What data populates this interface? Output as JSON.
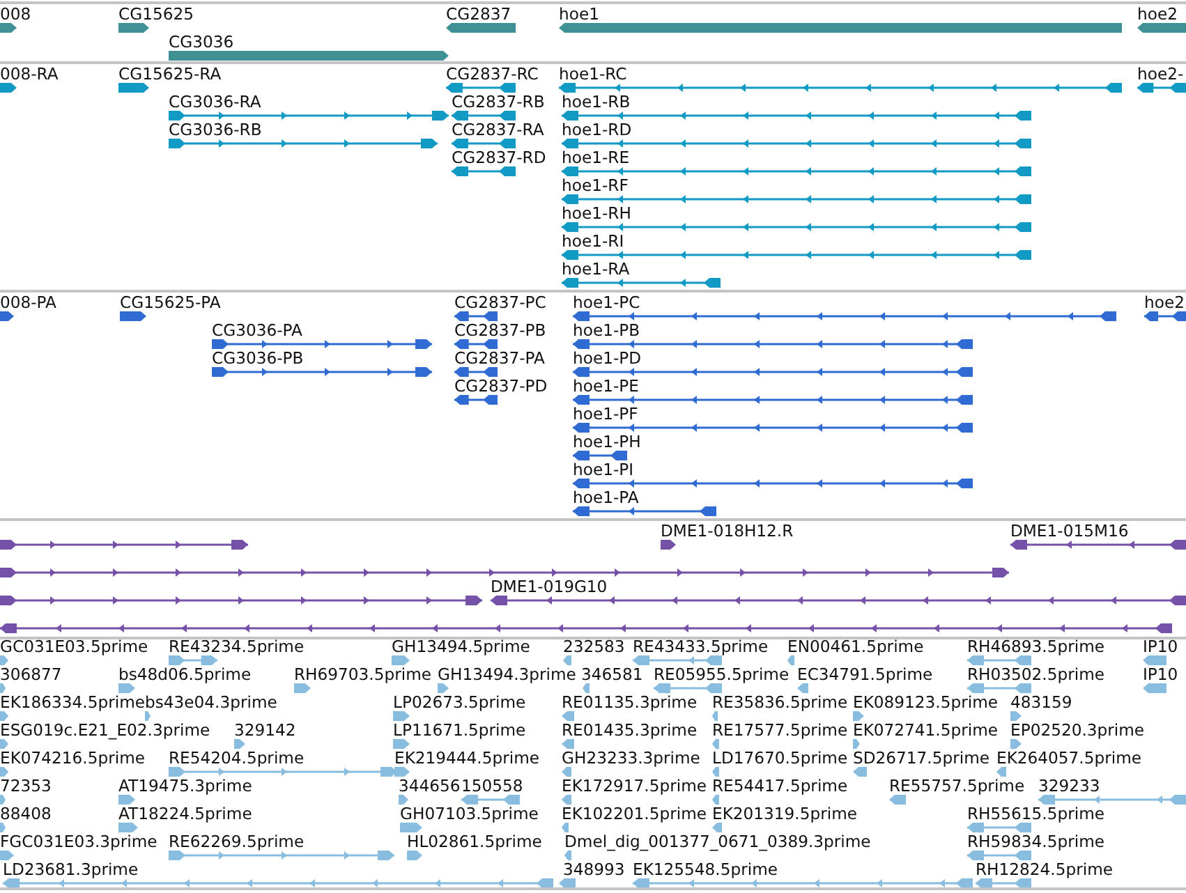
{
  "tracks": [
    {
      "kind": "gene",
      "features": [
        {
          "label": "008",
          "reverse": false
        },
        {
          "label": "CG15625",
          "reverse": false
        },
        {
          "label": "CG3036",
          "reverse": false
        },
        {
          "label": "CG2837",
          "reverse": true
        },
        {
          "label": "hoe1",
          "reverse": true
        },
        {
          "label": "hoe2",
          "reverse": true
        }
      ]
    },
    {
      "kind": "transcript",
      "features": [
        {
          "label": "008-RA",
          "reverse": false
        },
        {
          "label": "CG15625-RA",
          "reverse": false
        },
        {
          "label": "CG3036-RA",
          "reverse": false
        },
        {
          "label": "CG3036-RB",
          "reverse": false
        },
        {
          "label": "CG2837-RC",
          "reverse": true
        },
        {
          "label": "CG2837-RB",
          "reverse": true
        },
        {
          "label": "CG2837-RA",
          "reverse": true
        },
        {
          "label": "CG2837-RD",
          "reverse": true
        },
        {
          "label": "hoe1-RC",
          "reverse": true
        },
        {
          "label": "hoe1-RB",
          "reverse": true
        },
        {
          "label": "hoe1-RD",
          "reverse": true
        },
        {
          "label": "hoe1-RE",
          "reverse": true
        },
        {
          "label": "hoe1-RF",
          "reverse": true
        },
        {
          "label": "hoe1-RH",
          "reverse": true
        },
        {
          "label": "hoe1-RI",
          "reverse": true
        },
        {
          "label": "hoe1-RA",
          "reverse": true
        },
        {
          "label": "hoe2-",
          "reverse": true
        }
      ]
    },
    {
      "kind": "protein",
      "features": [
        {
          "label": "008-PA",
          "reverse": false
        },
        {
          "label": "CG15625-PA",
          "reverse": false
        },
        {
          "label": "CG3036-PA",
          "reverse": false
        },
        {
          "label": "CG3036-PB",
          "reverse": false
        },
        {
          "label": "CG2837-PC",
          "reverse": true
        },
        {
          "label": "CG2837-PB",
          "reverse": true
        },
        {
          "label": "CG2837-PA",
          "reverse": true
        },
        {
          "label": "CG2837-PD",
          "reverse": true
        },
        {
          "label": "hoe1-PC",
          "reverse": true
        },
        {
          "label": "hoe1-PB",
          "reverse": true
        },
        {
          "label": "hoe1-PD",
          "reverse": true
        },
        {
          "label": "hoe1-PE",
          "reverse": true
        },
        {
          "label": "hoe1-PF",
          "reverse": true
        },
        {
          "label": "hoe1-PH",
          "reverse": true
        },
        {
          "label": "hoe1-PI",
          "reverse": true
        },
        {
          "label": "hoe1-PA",
          "reverse": true
        },
        {
          "label": "hoe2",
          "reverse": true
        }
      ]
    },
    {
      "kind": "clone",
      "features": [
        {
          "reverse": false
        },
        {
          "label": "DME1-018H12.R",
          "reverse": false
        },
        {
          "label": "DME1-015M16",
          "reverse": true
        },
        {
          "reverse": false
        },
        {
          "reverse": false
        },
        {
          "label": "DME1-019G10",
          "reverse": true
        },
        {
          "reverse": true
        }
      ]
    },
    {
      "kind": "est",
      "features": [
        {
          "label": "GC031E03.5prime",
          "reverse": false
        },
        {
          "label": "RE43234.5prime",
          "reverse": false
        },
        {
          "label": "GH13494.5prime",
          "reverse": false
        },
        {
          "label": "232583",
          "reverse": true
        },
        {
          "label": "RE43433.5prime",
          "reverse": true
        },
        {
          "label": "EN00461.5prime",
          "reverse": true
        },
        {
          "label": "RH46893.5prime",
          "reverse": true
        },
        {
          "label": "IP10",
          "reverse": true
        },
        {
          "label": "306877",
          "reverse": false
        },
        {
          "label": "bs48d06.5prime",
          "reverse": false
        },
        {
          "label": "RH69703.5prime",
          "reverse": false
        },
        {
          "label": "GH13494.3prime",
          "reverse": false
        },
        {
          "label": "346581",
          "reverse": true
        },
        {
          "label": "RE05955.5prime",
          "reverse": true
        },
        {
          "label": "EC34791.5prime",
          "reverse": true
        },
        {
          "label": "RH03502.5prime",
          "reverse": true
        },
        {
          "label": "IP10",
          "reverse": true
        },
        {
          "label": "EK186334.5prime",
          "reverse": false
        },
        {
          "label": "bs43e04.3prime",
          "reverse": false
        },
        {
          "label": "LP02673.5prime",
          "reverse": false
        },
        {
          "label": "RE01135.3prime",
          "reverse": true
        },
        {
          "label": "RE35836.5prime",
          "reverse": true
        },
        {
          "label": "EK089123.5prime",
          "reverse": false
        },
        {
          "label": "483159",
          "reverse": false
        },
        {
          "label": "ESG019c.E21_E02.3prime",
          "reverse": false
        },
        {
          "label": "329142",
          "reverse": false
        },
        {
          "label": "LP11671.5prime",
          "reverse": false
        },
        {
          "label": "RE01435.3prime",
          "reverse": true
        },
        {
          "label": "RE17577.5prime",
          "reverse": true
        },
        {
          "label": "EK072741.5prime",
          "reverse": false
        },
        {
          "label": "EP02520.3prime",
          "reverse": false
        },
        {
          "label": "EK074216.5prime",
          "reverse": false
        },
        {
          "label": "RE54204.5prime",
          "reverse": false
        },
        {
          "label": "EK219444.5prime",
          "reverse": false
        },
        {
          "label": "GH23233.3prime",
          "reverse": true
        },
        {
          "label": "LD17670.5prime",
          "reverse": true
        },
        {
          "label": "SD26717.5prime",
          "reverse": true
        },
        {
          "label": "EK264057.5prime",
          "reverse": true
        },
        {
          "label": "72353",
          "reverse": false
        },
        {
          "label": "AT19475.3prime",
          "reverse": false
        },
        {
          "label": "344656",
          "reverse": false
        },
        {
          "label": "150558",
          "reverse": true
        },
        {
          "label": "EK172917.5prime",
          "reverse": true
        },
        {
          "label": "RE54417.5prime",
          "reverse": true
        },
        {
          "label": "RE55757.5prime",
          "reverse": true
        },
        {
          "label": "329233",
          "reverse": true
        },
        {
          "label": "88408",
          "reverse": false
        },
        {
          "label": "AT18224.5prime",
          "reverse": false
        },
        {
          "label": "GH07103.5prime",
          "reverse": false
        },
        {
          "label": "EK102201.5prime",
          "reverse": true
        },
        {
          "label": "EK201319.5prime",
          "reverse": true
        },
        {
          "label": "RH55615.5prime",
          "reverse": true
        },
        {
          "label": "FGC031E03.3prime",
          "reverse": false
        },
        {
          "label": "RE62269.5prime",
          "reverse": false
        },
        {
          "label": "HL02861.5prime",
          "reverse": false
        },
        {
          "label": "Dmel_dig_001377_0671_0389.3prime",
          "reverse": true
        },
        {
          "label": "RH59834.5prime",
          "reverse": true
        },
        {
          "label": "LD23681.3prime",
          "reverse": true
        },
        {
          "label": "348993",
          "reverse": true
        },
        {
          "label": "EK125548.5prime",
          "reverse": true
        },
        {
          "label": "RH12824.5prime",
          "reverse": true
        }
      ]
    }
  ]
}
